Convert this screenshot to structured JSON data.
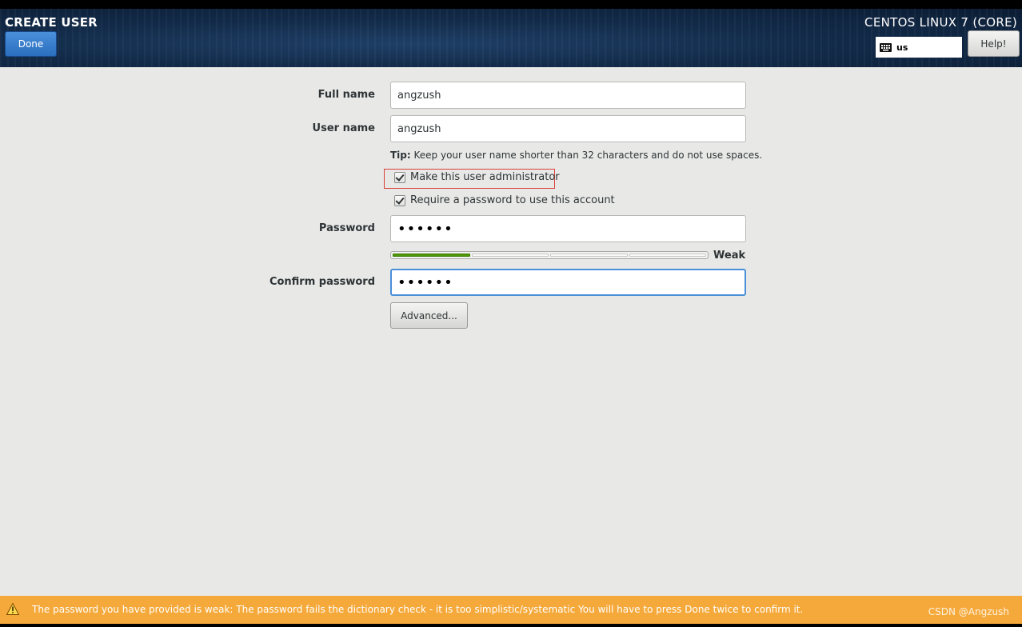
{
  "header": {
    "title": "CREATE USER",
    "product": "CENTOS LINUX 7 (CORE)",
    "done_label": "Done",
    "help_label": "Help!",
    "keyboard_layout": "us",
    "keyboard_icon": "keyboard-icon"
  },
  "form": {
    "full_name_label": "Full name",
    "full_name_value": "angzush",
    "user_name_label": "User name",
    "user_name_value": "angzush",
    "tip_prefix": "Tip:",
    "tip_text": " Keep your user name shorter than 32 characters and do not use spaces.",
    "admin_checkbox_label": "Make this user administrator",
    "admin_checked": true,
    "require_password_label": "Require a password to use this account",
    "require_password_checked": true,
    "password_label": "Password",
    "password_value": "••••••",
    "strength_label": "Weak",
    "strength_level": 0.25,
    "confirm_label": "Confirm password",
    "confirm_value": "••••••",
    "advanced_label": "Advanced..."
  },
  "warning": {
    "icon": "warning-icon",
    "text": "The password you have provided is weak: The password fails the dictionary check - it is too simplistic/systematic You will have to press Done twice to confirm it.",
    "watermark": "CSDN @Angzush"
  },
  "colors": {
    "header_bg": "#132c4b",
    "done_blue": "#2a6ec0",
    "strength_green": "#4e9a06",
    "warning_orange": "#f5a93a",
    "highlight_red": "#d9423a",
    "focus_blue": "#4a90d9"
  }
}
